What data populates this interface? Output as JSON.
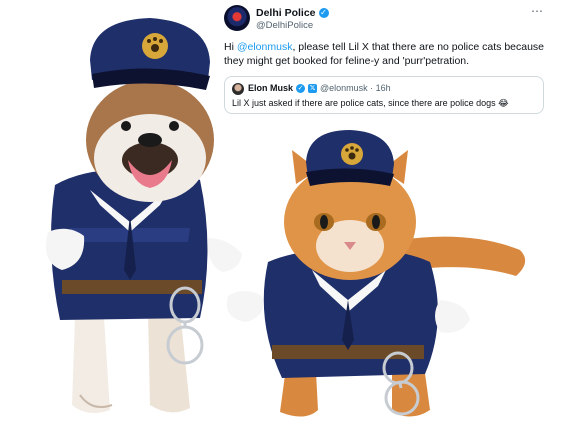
{
  "tweet": {
    "author_name": "Delhi Police",
    "author_handle": "@DelhiPolice",
    "more_icon": "⋯",
    "text_prefix": "Hi ",
    "mention": "@elonmusk",
    "text_suffix": ", please tell Lil X that there are no police cats because they might get booked for feline-y and 'purr'petration."
  },
  "quote": {
    "author_name": "Elon Musk",
    "x_badge": "𝕏",
    "handle_time": "@elonmusk · 16h",
    "text": "Lil X just asked if there are police cats, since there are police dogs 😂"
  },
  "colors": {
    "accent": "#1d9bf0",
    "uniform": "#1f2f6a",
    "cat_fur": "#d9893f"
  },
  "icons": {
    "verified": "check-badge-icon",
    "more": "more-horizontal-icon",
    "hat_badge": "paw-badge-icon",
    "handcuffs": "handcuffs-icon"
  }
}
